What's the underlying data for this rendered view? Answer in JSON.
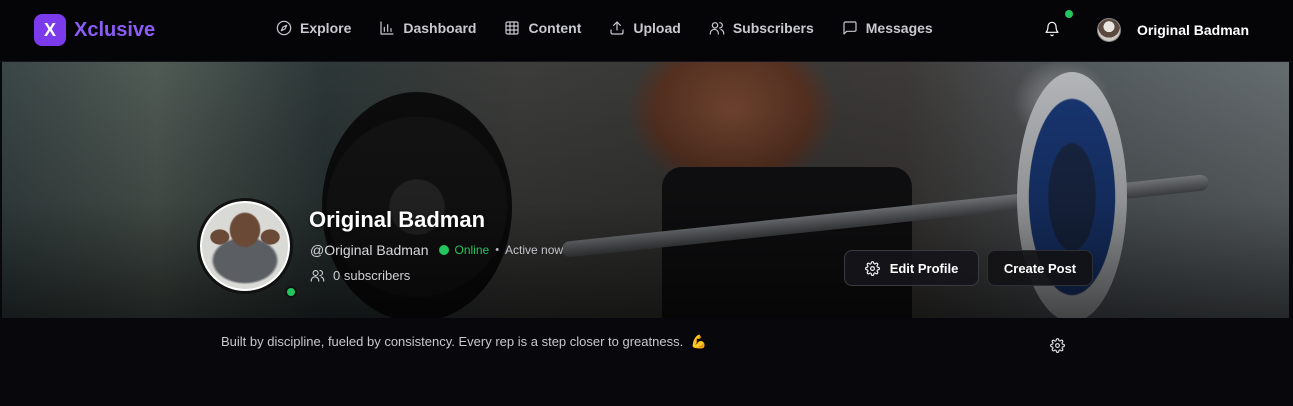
{
  "brand": {
    "logo_letter": "X",
    "name": "Xclusive",
    "accent": "#8b5cf6"
  },
  "nav": {
    "items": [
      {
        "label": "Explore",
        "icon": "compass-icon"
      },
      {
        "label": "Dashboard",
        "icon": "bar-chart-icon"
      },
      {
        "label": "Content",
        "icon": "grid-icon"
      },
      {
        "label": "Upload",
        "icon": "upload-icon"
      },
      {
        "label": "Subscribers",
        "icon": "users-icon"
      },
      {
        "label": "Messages",
        "icon": "message-icon"
      }
    ]
  },
  "header": {
    "notification_icon": "bell-icon",
    "user_name": "Original Badman"
  },
  "profile": {
    "name": "Original Badman",
    "handle": "@Original Badman",
    "status": "Online",
    "separator": "•",
    "activity": "Active now",
    "subscribers": "0 subscribers",
    "status_color": "#22c55e"
  },
  "actions": {
    "edit_label": "Edit Profile",
    "create_label": "Create Post"
  },
  "bio": {
    "text": "Built by discipline, fueled by consistency. Every rep is a step closer to greatness.",
    "emoji": "💪"
  }
}
